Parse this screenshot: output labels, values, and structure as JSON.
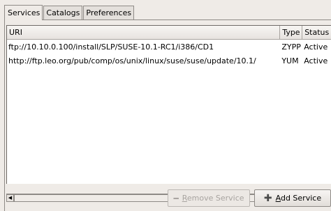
{
  "tabs": [
    {
      "label": "Services",
      "active": true
    },
    {
      "label": "Catalogs",
      "active": false
    },
    {
      "label": "Preferences",
      "active": false
    }
  ],
  "table": {
    "columns": [
      "URI",
      "Type",
      "Status"
    ],
    "rows": [
      {
        "uri": "ftp://10.10.0.100/install/SLP/SUSE-10.1-RC1/i386/CD1",
        "type": "ZYPP",
        "status": "Active"
      },
      {
        "uri": "http://ftp.leo.org/pub/comp/os/unix/linux/suse/suse/update/10.1/",
        "type": "YUM",
        "status": "Active"
      }
    ]
  },
  "buttons": {
    "remove": {
      "mnemonic": "R",
      "rest": "emove Service",
      "icon": "minus-icon",
      "enabled": false
    },
    "add": {
      "mnemonic": "A",
      "rest": "dd Service",
      "icon": "plus-icon",
      "enabled": true
    }
  }
}
